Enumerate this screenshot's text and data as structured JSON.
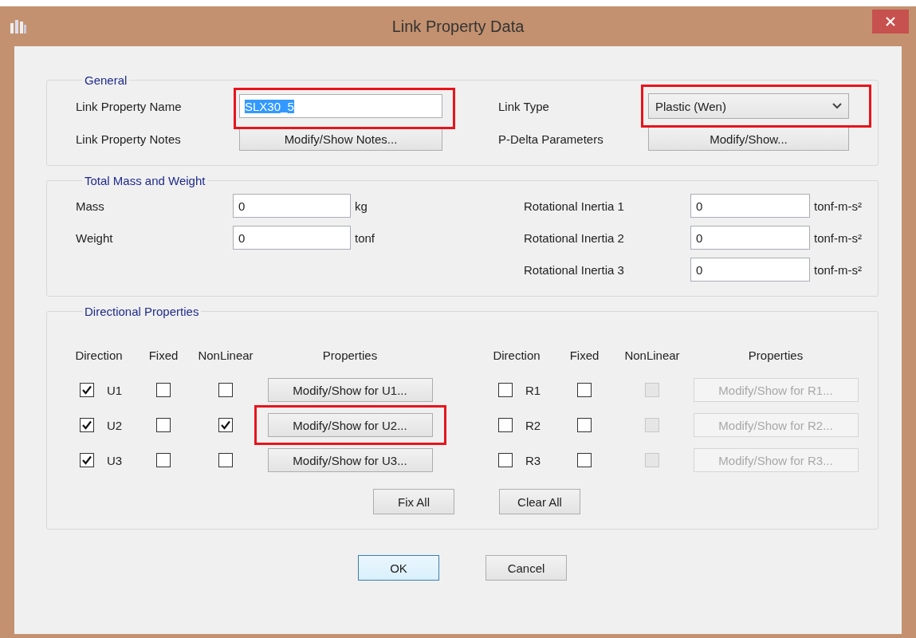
{
  "window": {
    "title": "Link Property Data"
  },
  "general": {
    "title": "General",
    "name_label": "Link Property Name",
    "name_value": "SLX30_5",
    "name_selected": true,
    "name_highlighted": true,
    "notes_label": "Link Property Notes",
    "notes_button": "Modify/Show Notes...",
    "type_label": "Link Type",
    "type_value": "Plastic (Wen)",
    "type_highlighted": true,
    "pdelta_label": "P-Delta Parameters",
    "pdelta_button": "Modify/Show..."
  },
  "mass": {
    "title": "Total Mass and Weight",
    "left_fields": [
      {
        "label": "Mass",
        "value": "0",
        "unit": "kg"
      },
      {
        "label": "Weight",
        "value": "0",
        "unit": "tonf"
      }
    ],
    "right_fields": [
      {
        "label": "Rotational Inertia 1",
        "value": "0",
        "unit": "tonf-m-s²"
      },
      {
        "label": "Rotational Inertia 2",
        "value": "0",
        "unit": "tonf-m-s²"
      },
      {
        "label": "Rotational Inertia 3",
        "value": "0",
        "unit": "tonf-m-s²"
      }
    ]
  },
  "directional": {
    "title": "Directional Properties",
    "headers_left": [
      "Direction",
      "Fixed",
      "NonLinear",
      "Properties"
    ],
    "headers_right": [
      "Direction",
      "Fixed",
      "NonLinear",
      "Properties"
    ],
    "rows_left": [
      {
        "direction": "U1",
        "checked": true,
        "fixed": false,
        "nonlinear": false,
        "nonlinear_disabled": false,
        "button": "Modify/Show for U1...",
        "button_disabled": false,
        "highlighted": false
      },
      {
        "direction": "U2",
        "checked": true,
        "fixed": false,
        "nonlinear": true,
        "nonlinear_disabled": false,
        "button": "Modify/Show for U2...",
        "button_disabled": false,
        "highlighted": true
      },
      {
        "direction": "U3",
        "checked": true,
        "fixed": false,
        "nonlinear": false,
        "nonlinear_disabled": false,
        "button": "Modify/Show for U3...",
        "button_disabled": false,
        "highlighted": false
      }
    ],
    "rows_right": [
      {
        "direction": "R1",
        "checked": false,
        "fixed": false,
        "nonlinear": false,
        "nonlinear_disabled": true,
        "button": "Modify/Show for R1...",
        "button_disabled": true,
        "highlighted": false
      },
      {
        "direction": "R2",
        "checked": false,
        "fixed": false,
        "nonlinear": false,
        "nonlinear_disabled": true,
        "button": "Modify/Show for R2...",
        "button_disabled": true,
        "highlighted": false
      },
      {
        "direction": "R3",
        "checked": false,
        "fixed": false,
        "nonlinear": false,
        "nonlinear_disabled": true,
        "button": "Modify/Show for R3...",
        "button_disabled": true,
        "highlighted": false
      }
    ],
    "buttons": [
      "Fix All",
      "Clear All"
    ]
  },
  "buttons": [
    {
      "label": "OK",
      "default": true
    },
    {
      "label": "Cancel",
      "default": false
    }
  ]
}
